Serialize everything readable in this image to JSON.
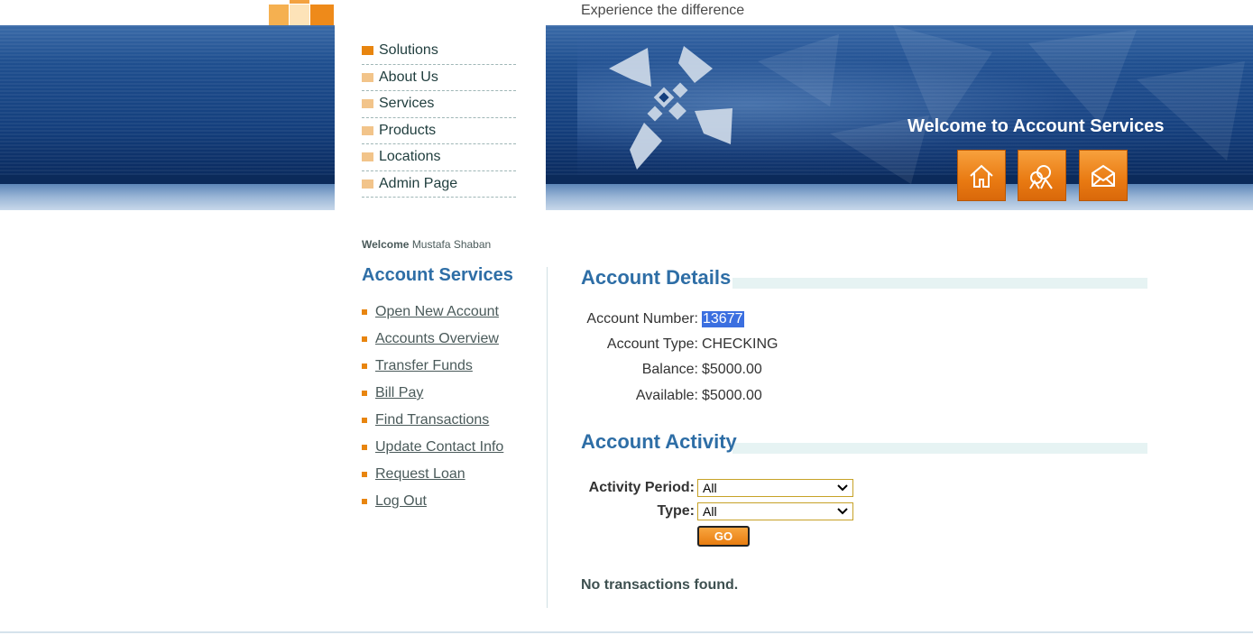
{
  "header": {
    "tagline": "Experience the difference"
  },
  "banner": {
    "welcome": "Welcome to Account Services",
    "icons": [
      "home-icon",
      "contact-icon",
      "mail-icon"
    ],
    "icon_color": "#e97a12"
  },
  "nav": {
    "items": [
      {
        "label": "Solutions"
      },
      {
        "label": "About Us"
      },
      {
        "label": "Services"
      },
      {
        "label": "Products"
      },
      {
        "label": "Locations"
      },
      {
        "label": "Admin Page"
      }
    ]
  },
  "user": {
    "welcome_label": "Welcome",
    "name": "Mustafa Shaban"
  },
  "sidebar": {
    "title": "Account Services",
    "links": [
      {
        "label": "Open New Account"
      },
      {
        "label": "Accounts Overview"
      },
      {
        "label": "Transfer Funds"
      },
      {
        "label": "Bill Pay"
      },
      {
        "label": "Find Transactions"
      },
      {
        "label": "Update Contact Info"
      },
      {
        "label": "Request Loan"
      },
      {
        "label": "Log Out"
      }
    ]
  },
  "details": {
    "title": "Account Details",
    "account_number_label": "Account Number:",
    "account_number": "13677",
    "account_type_label": "Account Type:",
    "account_type": "CHECKING",
    "balance_label": "Balance:",
    "balance": "$5000.00",
    "available_label": "Available:",
    "available": "$5000.00"
  },
  "activity": {
    "title": "Account Activity",
    "period_label": "Activity Period:",
    "period_value": "All",
    "type_label": "Type:",
    "type_value": "All",
    "go_label": "GO",
    "empty_message": "No transactions found."
  },
  "colors": {
    "accent_blue": "#2e6ea6",
    "accent_orange": "#e8850f",
    "banner_blue": "#143f7d"
  }
}
